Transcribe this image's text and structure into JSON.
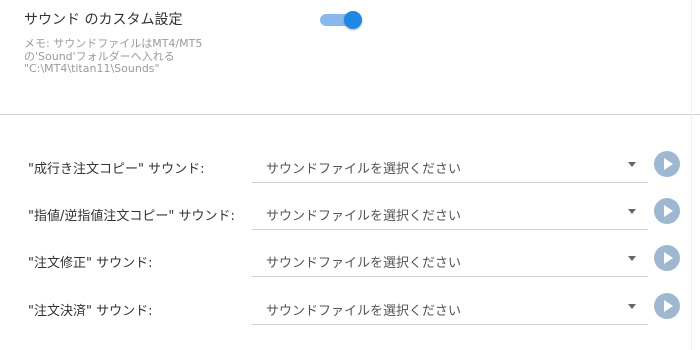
{
  "custom_sound": {
    "title": "サウンド のカスタム設定",
    "enabled": true,
    "memo": "メモ: サウンドファイルはMT4/MT5\nの'Sound'フォルダーへ入れる\n\"C:\\MT4\\titan11\\Sounds\""
  },
  "sound_rows": [
    {
      "label": "\"成行き注文コピー\" サウンド:",
      "value": "サウンドファイルを選択ください"
    },
    {
      "label": "\"指値/逆指値注文コピー\" サウンド:",
      "value": "サウンドファイルを選択ください"
    },
    {
      "label": "\"注文修正\" サウンド:",
      "value": "サウンドファイルを選択ください"
    },
    {
      "label": "\"注文決済\" サウンド:",
      "value": "サウンドファイルを選択ください"
    }
  ],
  "colors": {
    "toggle_on": "#1e88e5",
    "play_button": "#9fb8d2"
  },
  "icons": {
    "dropdown": "chevron-down-icon",
    "play": "play-icon"
  }
}
